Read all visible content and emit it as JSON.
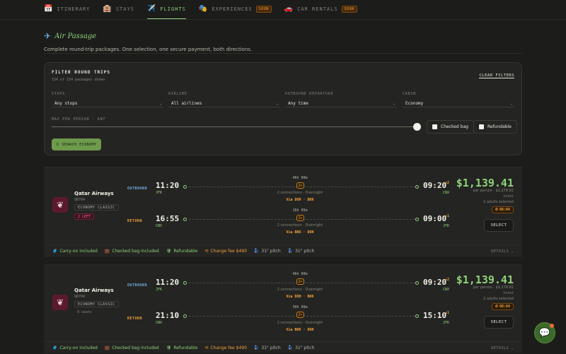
{
  "tabs": [
    {
      "icon": "📅",
      "label": "ITINERARY"
    },
    {
      "icon": "🏨",
      "label": "STAYS"
    },
    {
      "icon": "✈️",
      "label": "FLIGHTS"
    },
    {
      "icon": "🎭",
      "label": "EXPERIENCES",
      "badge": "SOON"
    },
    {
      "icon": "🚗",
      "label": "CAR RENTALS",
      "badge": "SOON"
    }
  ],
  "hero": {
    "icon": "✈",
    "title": "Air Passage",
    "subtitle": "Complete round-trip packages. One selection, one secure payment, both directions."
  },
  "filter": {
    "title": "FILTER ROUND TRIPS",
    "count": "154 of 154 packages shown",
    "clear": "CLEAR FILTERS",
    "fields": [
      {
        "label": "STOPS",
        "value": "Any stops"
      },
      {
        "label": "AIRLINE",
        "value": "All airlines"
      },
      {
        "label": "OUTBOUND DEPARTURE",
        "value": "Any time"
      },
      {
        "label": "CABIN",
        "value": "Economy"
      }
    ],
    "max_label": "MAX PER PERSON · ANY",
    "checked_bag": "Checked bag",
    "refundable": "Refundable",
    "search": "SEARCH ECONOMY",
    "chevron": "⌄"
  },
  "cards": [
    {
      "airline": "Qatar Airways",
      "flight": "QR704",
      "cabin": "ECONOMY CLASSIC",
      "availability": "2 LEFT",
      "outbound": {
        "dir": "OUTBOUND",
        "dep": "11:20",
        "from": "JFK",
        "arr": "09:20",
        "plus": "+2",
        "to": "CNX",
        "duration": "46h 00m",
        "stops": "2+",
        "connections": "2 connections · Overnight",
        "via": "Via DOH · BKK"
      },
      "return": {
        "dir": "RETURN",
        "dep": "16:55",
        "from": "CNX",
        "arr": "09:00",
        "plus": "+1",
        "to": "JFK",
        "duration": "16h 05m",
        "stops": "2+",
        "connections": "2 connections · Overnight",
        "via": "Via BKK · DOH"
      },
      "price": "$1,139.41",
      "per_person": "per person · $2,278.82",
      "total": "total",
      "adults": "2 adults selected",
      "timer": "08:04",
      "select": "SELECT",
      "amenities": [
        {
          "icon": "🧳",
          "label": "Carry-on included",
          "tone": "g"
        },
        {
          "icon": "💼",
          "label": "Checked bag included",
          "tone": "g"
        },
        {
          "icon": "🛡",
          "label": "Refundable",
          "tone": "g"
        },
        {
          "icon": "⟲",
          "label": "Change fee $490",
          "tone": "o"
        },
        {
          "icon": "💺",
          "label": "31\" pitch",
          "tone": "w"
        },
        {
          "icon": "💺",
          "label": "31\" pitch",
          "tone": "w"
        }
      ],
      "details": "DETAILS ⌄"
    },
    {
      "airline": "Qatar Airways",
      "flight": "QR704",
      "cabin": "ECONOMY CLASSIC",
      "seats": "9 seats",
      "outbound": {
        "dir": "OUTBOUND",
        "dep": "11:20",
        "from": "JFK",
        "arr": "09:20",
        "plus": "+2",
        "to": "CNX",
        "duration": "46h 00m",
        "stops": "2+",
        "connections": "2 connections · Overnight",
        "via": "Via DOH · BKK"
      },
      "return": {
        "dir": "RETURN",
        "dep": "21:10",
        "from": "CNX",
        "arr": "15:10",
        "plus": "+1",
        "to": "JFK",
        "duration": "30h 00m",
        "stops": "2+",
        "connections": "2 connections · Overnight",
        "via": "Via BKK · DOH"
      },
      "price": "$1,139.41",
      "per_person": "per person · $2,278.82",
      "total": "total",
      "adults": "2 adults selected",
      "timer": "08:04",
      "select": "SELECT",
      "amenities": [
        {
          "icon": "🧳",
          "label": "Carry-on included",
          "tone": "g"
        },
        {
          "icon": "💼",
          "label": "Checked bag included",
          "tone": "g"
        },
        {
          "icon": "🛡",
          "label": "Refundable",
          "tone": "g"
        },
        {
          "icon": "⟲",
          "label": "Change fee $490",
          "tone": "o"
        },
        {
          "icon": "💺",
          "label": "31\" pitch",
          "tone": "w"
        },
        {
          "icon": "💺",
          "label": "31\" pitch",
          "tone": "w"
        }
      ],
      "details": "DETAILS ⌄"
    }
  ],
  "chat_icon": "💬",
  "colors": {
    "accent": "#8fd37a",
    "warning": "#f3a23a",
    "outbound": "#6fb2e6",
    "danger": "#f06a86"
  }
}
